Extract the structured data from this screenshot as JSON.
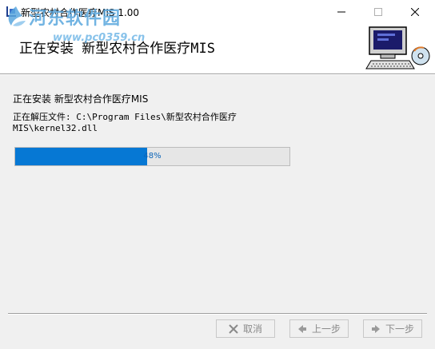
{
  "window": {
    "title": "新型农村合作医疗MIS 1.00",
    "controls": {
      "minimize": "—",
      "maximize": "☐",
      "close": "✕"
    }
  },
  "watermark": {
    "text": "河东软件园",
    "url": "www.pc0359.cn"
  },
  "header": {
    "title": "正在安装 新型农村合作医疗MIS"
  },
  "main": {
    "status": "正在安装 新型农村合作医疗MIS",
    "extract_line": "正在解压文件: C:\\Program Files\\新型农村合作医疗MIS\\kernel32.dll",
    "progress_label": "48%",
    "progress_value": 0.48
  },
  "footer": {
    "cancel_label": "取消",
    "back_label": "上一步",
    "next_label": "下一步"
  },
  "colors": {
    "progress_fill": "#0678d4",
    "watermark": "#5aa7de"
  }
}
